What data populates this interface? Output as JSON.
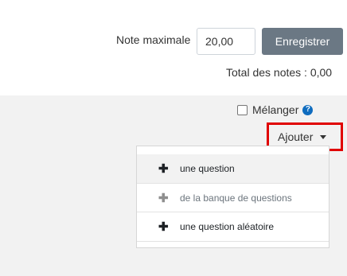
{
  "grade": {
    "label": "Note maximale",
    "value": "20,00",
    "save_label": "Enregistrer",
    "total_label": "Total des notes : 0,00"
  },
  "shuffle": {
    "label": "Mélanger",
    "checked": false,
    "help_icon": "question-circle-icon"
  },
  "add_menu": {
    "button_label": "Ajouter",
    "items": [
      {
        "label": "une question",
        "icon": "plus-icon"
      },
      {
        "label": "de la banque de questions",
        "icon": "plus-icon"
      },
      {
        "label": "une question aléatoire",
        "icon": "plus-icon"
      }
    ]
  },
  "colors": {
    "save_button": "#6b7884",
    "help_icon": "#0f6cbf",
    "highlight": "#e00000"
  }
}
